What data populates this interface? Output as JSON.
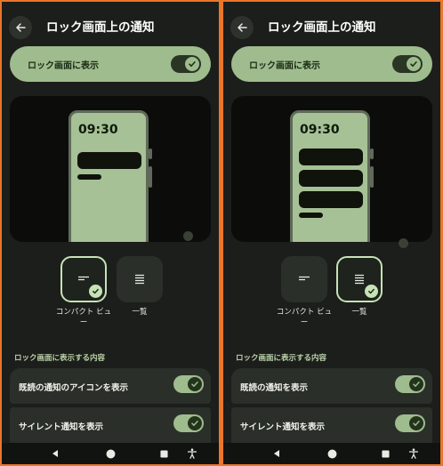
{
  "screens": [
    {
      "title": "ロック画面上の通知",
      "master_toggle": {
        "label": "ロック画面に表示",
        "on": true
      },
      "preview": {
        "time": "09:30",
        "notification_count": 1,
        "style": "compact"
      },
      "styles": [
        {
          "label": "コンパクト ビュー",
          "selected": true,
          "icon": "compact-lines-icon"
        },
        {
          "label": "一覧",
          "selected": false,
          "icon": "list-lines-icon"
        }
      ],
      "section_header": "ロック画面に表示する内容",
      "rows": [
        {
          "label": "既読の通知のアイコンを表示",
          "on": true
        },
        {
          "label": "サイレント通知を表示",
          "on": true
        }
      ]
    },
    {
      "title": "ロック画面上の通知",
      "master_toggle": {
        "label": "ロック画面に表示",
        "on": true
      },
      "preview": {
        "time": "09:30",
        "notification_count": 3,
        "style": "full"
      },
      "styles": [
        {
          "label": "コンパクト ビュー",
          "selected": false,
          "icon": "compact-lines-icon"
        },
        {
          "label": "一覧",
          "selected": true,
          "icon": "list-lines-icon"
        }
      ],
      "section_header": "ロック画面に表示する内容",
      "rows": [
        {
          "label": "既読の通知を表示",
          "on": true
        },
        {
          "label": "サイレント通知を表示",
          "on": true
        }
      ]
    }
  ],
  "nav_icons": [
    "back-triangle-icon",
    "home-circle-icon",
    "recents-square-icon",
    "accessibility-icon"
  ],
  "colors": {
    "background": "#1b1e1a",
    "accent": "#9ebc8d",
    "frame": "#e9762b",
    "selected_outline": "#c7e2b5"
  }
}
